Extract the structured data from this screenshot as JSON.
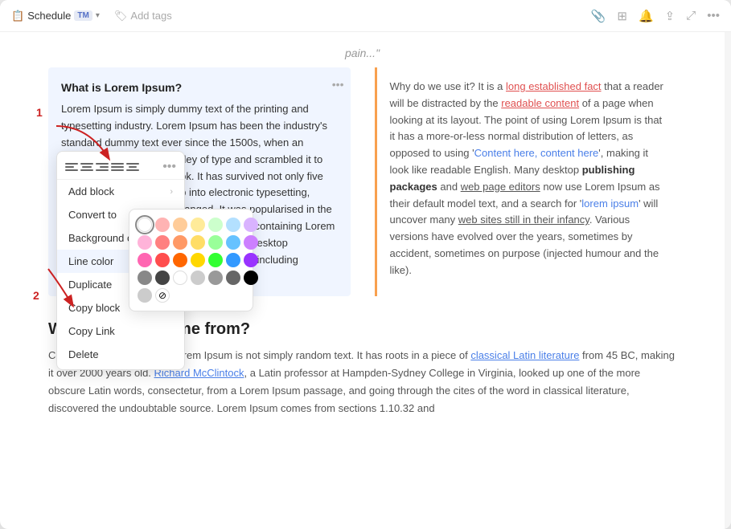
{
  "titlebar": {
    "schedule_label": "Schedule",
    "tag_badge": "TM",
    "chevron": "▾",
    "add_tags": "Add tags",
    "tag_icon": "🏷",
    "icons": {
      "attachment": "📎",
      "grid": "⊞",
      "bell": "🔔",
      "share": "⇪",
      "expand": "⤢",
      "more": "•••"
    }
  },
  "page": {
    "header": "pain...\"",
    "col_left": {
      "title": "What is Lorem Ipsum?",
      "text": "Lorem Ipsum is simply dummy text of the printing and typesetting industry. Lorem Ipsum has been the industry's standard dummy text ever since the 1500s, when an unknown printer took a galley of type and scrambled it to make a type specimen book. It has survived not only five centuries, but also the leap into electronic typesetting, remaining essentially unchanged. It was popularised in the 1960s with the release of Letraset sheets containing Lorem Ipsum passages, and more recently with desktop publishing software like Aldus PageMaker including versions of Lorem Ipsum."
    },
    "col_right": {
      "text": "Why do we use it? It is a long established fact that a reader will be distracted by the readable content of a page when looking at its layout. The point of using Lorem Ipsum is that it has a more-or-less normal distribution of letters, as opposed to using 'Content here, content here', making it look like readable English. Many desktop publishing packages and web page editors now use Lorem Ipsum as their default model text, and a search for 'lorem ipsum' will uncover many web sites still in their infancy. Various versions have evolved over the years, sometimes by accident, sometimes on purpose (injected humour and the like)."
    },
    "section": {
      "title": "Where does it come from?",
      "text": "Contrary to popular belief, Lorem Ipsum is not simply random text. It has roots in a piece of classical Latin literature from 45 BC, making it over 2000 years old. Richard McClintock, a Latin professor at Hampden-Sydney College in Virginia, looked up one of the more obscure Latin words, consectetur, from a Lorem Ipsum passage, and going through the cites of the word in classical literature, discovered the undoubtable source. Lorem Ipsum comes from sections 1.10.32 and"
    }
  },
  "context_menu": {
    "items": [
      {
        "label": "Add block",
        "has_arrow": true
      },
      {
        "label": "Convert to",
        "has_arrow": true
      },
      {
        "label": "Background color",
        "has_arrow": true
      },
      {
        "label": "Line color",
        "has_arrow": true,
        "active": true
      },
      {
        "label": "Duplicate",
        "has_arrow": false
      },
      {
        "label": "Copy block",
        "has_arrow": false
      },
      {
        "label": "Copy Link",
        "has_arrow": false
      },
      {
        "label": "Delete",
        "has_arrow": false
      }
    ]
  },
  "color_palette": {
    "colors": [
      "#ffffff",
      "#ffb3b3",
      "#ffcc99",
      "#ffeb99",
      "#ccffcc",
      "#b3e0ff",
      "#d9b3ff",
      "#ffb3d9",
      "#ff8080",
      "#ff9966",
      "#ffdd66",
      "#99ff99",
      "#66c2ff",
      "#cc80ff",
      "#ff66b2",
      "#ff4d4d",
      "#ff6600",
      "#ffd700",
      "#33ff33",
      "#3399ff",
      "#9933ff",
      "#888888",
      "#444444",
      "#ffffff",
      "#cccccc",
      "#999999",
      "#666666",
      "#000000",
      "#cccccc",
      "#eeeeee"
    ],
    "selected_index": 0,
    "no_color_icon": "⊘"
  },
  "annotations": {
    "one": "1",
    "two": "2"
  }
}
